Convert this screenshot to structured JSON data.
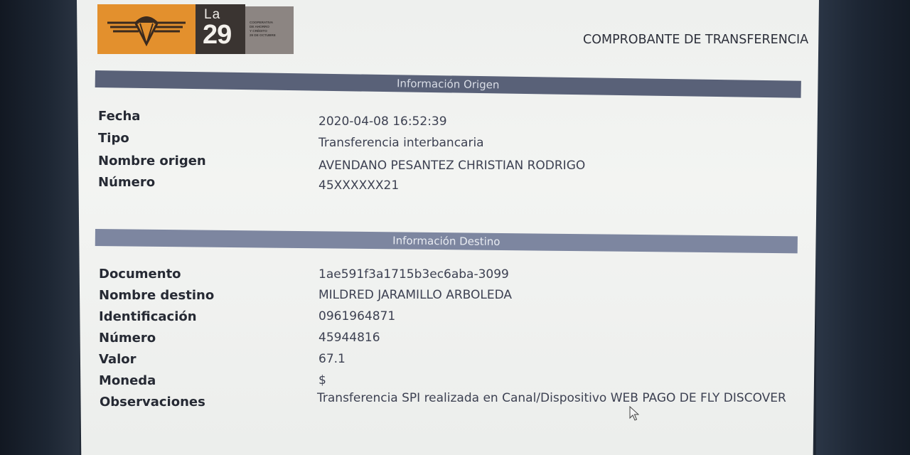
{
  "logo": {
    "la": "La",
    "number": "29",
    "small_text": [
      "COOPERATIVA",
      "DE AHORRO",
      "Y CRÉDITO",
      "29 DE OCTUBRE"
    ]
  },
  "document_title": "COMPROBANTE DE TRANSFERENCIA",
  "origin": {
    "header": "Información Origen",
    "rows": [
      {
        "label": "Fecha",
        "value": "2020-04-08 16:52:39"
      },
      {
        "label": "Tipo",
        "value": "Transferencia interbancaria"
      },
      {
        "label": "Nombre origen",
        "value": "AVENDANO PESANTEZ CHRISTIAN RODRIGO"
      },
      {
        "label": "Número",
        "value": "45XXXXXX21"
      }
    ]
  },
  "destination": {
    "header": "Información Destino",
    "rows": [
      {
        "label": "Documento",
        "value": "1ae591f3a1715b3ec6aba-3099"
      },
      {
        "label": "Nombre destino",
        "value": "MILDRED JARAMILLO ARBOLEDA"
      },
      {
        "label": "Identificación",
        "value": "0961964871"
      },
      {
        "label": "Número",
        "value": "45944816"
      },
      {
        "label": "Valor",
        "value": "67.1"
      },
      {
        "label": "Moneda",
        "value": "$"
      },
      {
        "label": "Observaciones",
        "value": "Transferencia SPI realizada en Canal/Dispositivo WEB PAGO DE FLY DISCOVER"
      }
    ]
  },
  "colors": {
    "logo_orange": "#e3902d",
    "logo_dark": "#3a3431",
    "section_bar": "#596178",
    "section_bar_light": "#7d86a0"
  },
  "icons": [
    "winged-parachute-logo-icon",
    "mouse-pointer-icon"
  ]
}
